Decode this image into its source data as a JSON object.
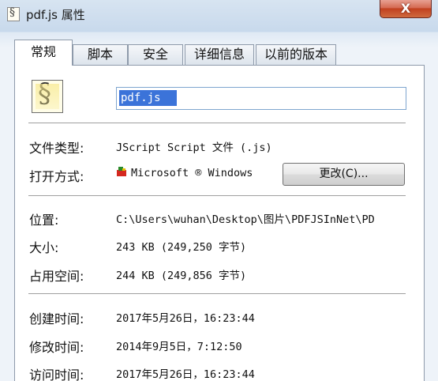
{
  "window": {
    "title": "pdf.js 属性",
    "close_label": "X"
  },
  "tabs": [
    {
      "label": "常规",
      "active": true
    },
    {
      "label": "脚本",
      "active": false
    },
    {
      "label": "安全",
      "active": false
    },
    {
      "label": "详细信息",
      "active": false
    },
    {
      "label": "以前的版本",
      "active": false
    }
  ],
  "general": {
    "file_icon": "script-file-icon",
    "file_name": "pdf.js",
    "type_label": "文件类型:",
    "type_value": "JScript Script 文件 (.js)",
    "open_with_label": "打开方式:",
    "open_with_value": "Microsoft ® Windows",
    "open_with_icon": "windows-script-host-icon",
    "change_button": "更改(C)...",
    "location_label": "位置:",
    "location_value": "C:\\Users\\wuhan\\Desktop\\图片\\PDFJSInNet\\PD",
    "size_label": "大小:",
    "size_value": "243 KB (249,250 字节)",
    "size_on_disk_label": "占用空间:",
    "size_on_disk_value": "244 KB (249,856 字节)",
    "created_label": "创建时间:",
    "created_value": "2017年5月26日，16:23:44",
    "modified_label": "修改时间:",
    "modified_value": "2014年9月5日，7:12:50",
    "accessed_label": "访问时间:",
    "accessed_value": "2017年5月26日，16:23:44"
  },
  "colors": {
    "selection": "#3b73d9",
    "close_button": "#c8462a"
  }
}
